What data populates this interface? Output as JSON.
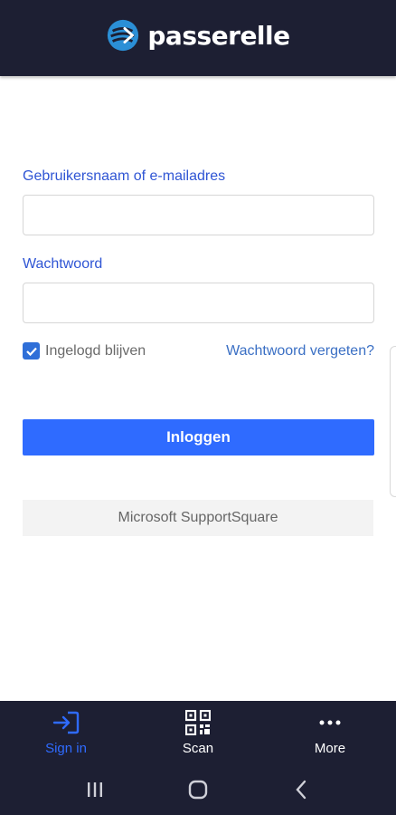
{
  "header": {
    "brand_name": "passerelle",
    "logo_icon": "passerelle-logo-icon"
  },
  "form": {
    "username_label": "Gebruikersnaam of e-mailadres",
    "username_value": "",
    "password_label": "Wachtwoord",
    "password_value": "",
    "remember_label": "Ingelogd blijven",
    "remember_checked": true,
    "forgot_link": "Wachtwoord vergeten?",
    "login_button": "Inloggen",
    "ms_button": "Microsoft SupportSquare"
  },
  "bottom_nav": {
    "items": [
      {
        "label": "Sign in",
        "icon": "sign-in-icon",
        "active": true
      },
      {
        "label": "Scan",
        "icon": "qr-code-icon",
        "active": false
      },
      {
        "label": "More",
        "icon": "more-dots-icon",
        "active": false
      }
    ]
  },
  "system_bar": {
    "buttons": [
      "recents-icon",
      "home-icon",
      "back-icon"
    ]
  },
  "colors": {
    "header_bg": "#1d1f33",
    "accent": "#2f6bff",
    "label": "#2f55d4"
  }
}
